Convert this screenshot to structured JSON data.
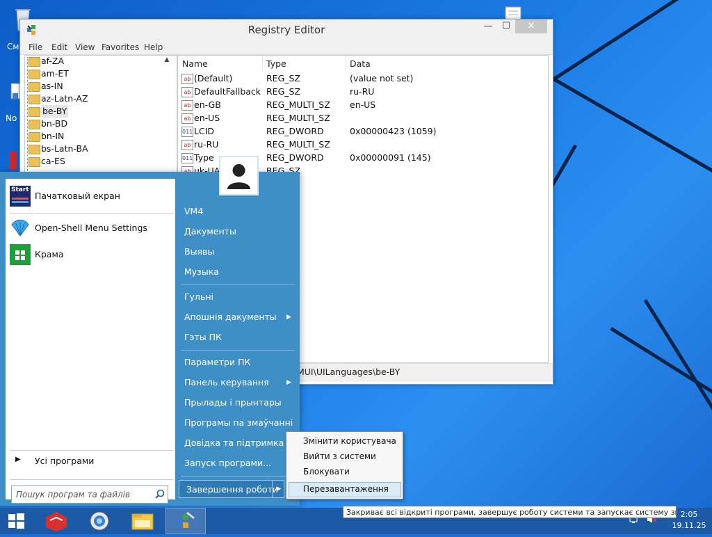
{
  "window": {
    "title": "Registry Editor",
    "minimize": "—",
    "maximize": "☐",
    "close": "✕"
  },
  "menubar": [
    "File",
    "Edit",
    "View",
    "Favorites",
    "Help"
  ],
  "tree_items": [
    "af-ZA",
    "am-ET",
    "as-IN",
    "az-Latn-AZ",
    "be-BY",
    "bn-BD",
    "bn-IN",
    "bs-Latn-BA",
    "ca-ES"
  ],
  "columns": {
    "name": "Name",
    "type": "Type",
    "data": "Data"
  },
  "values": [
    {
      "name": "(Default)",
      "type": "REG_SZ",
      "data": "(value not set)",
      "icon": "ab"
    },
    {
      "name": "DefaultFallback",
      "type": "REG_SZ",
      "data": "ru-RU",
      "icon": "ab"
    },
    {
      "name": "en-GB",
      "type": "REG_MULTI_SZ",
      "data": "en-US",
      "icon": "ab"
    },
    {
      "name": "en-US",
      "type": "REG_MULTI_SZ",
      "data": "",
      "icon": "ab"
    },
    {
      "name": "LCID",
      "type": "REG_DWORD",
      "data": "0x00000423 (1059)",
      "icon": "011"
    },
    {
      "name": "ru-RU",
      "type": "REG_MULTI_SZ",
      "data": "",
      "icon": "ab"
    },
    {
      "name": "Type",
      "type": "REG_DWORD",
      "data": "0x00000091 (145)",
      "icon": "011"
    },
    {
      "name": "uk-UA",
      "type": "REG_SZ",
      "data": "",
      "icon": "ab"
    }
  ],
  "statusbar": "MUI\\UILanguages\\be-BY",
  "start_menu": {
    "pinned": [
      {
        "label": "Пачатковый екран",
        "icon": "start-screen-icon"
      },
      {
        "label": "Open-Shell Menu Settings",
        "icon": "shell-icon"
      },
      {
        "label": "Крама",
        "icon": "store-icon"
      }
    ],
    "all_programs": "Усі програми",
    "search_placeholder": "Пошук програм та файлів",
    "right": {
      "user": "VM4",
      "documents": "Дакументы",
      "pictures": "Выявы",
      "music": "Музыка",
      "games": "Гульні",
      "recent": "Апошнія дакументы",
      "computer": "Гэты ПК",
      "pc_settings": "Параметри ПК",
      "control_panel": "Панель керування",
      "devices": "Прылады і прынтары",
      "default_programs": "Програмы па змаўчанні",
      "help": "Довідка та підтримка",
      "run": "Запуск програми...",
      "shutdown": "Завершення роботи"
    },
    "start_tile_text": "Start"
  },
  "shutdown_submenu": [
    "Змінити користувача",
    "Вийти з системи",
    "Блокувати",
    "Перезавантаження"
  ],
  "tooltip": "Закриває всі відкриті програми, завершує роботу системи та запускає систему знову.",
  "clock": {
    "time": "2:05",
    "date": "19.11.25"
  },
  "desktop_labels": {
    "left1": "См",
    "left2": "No"
  }
}
